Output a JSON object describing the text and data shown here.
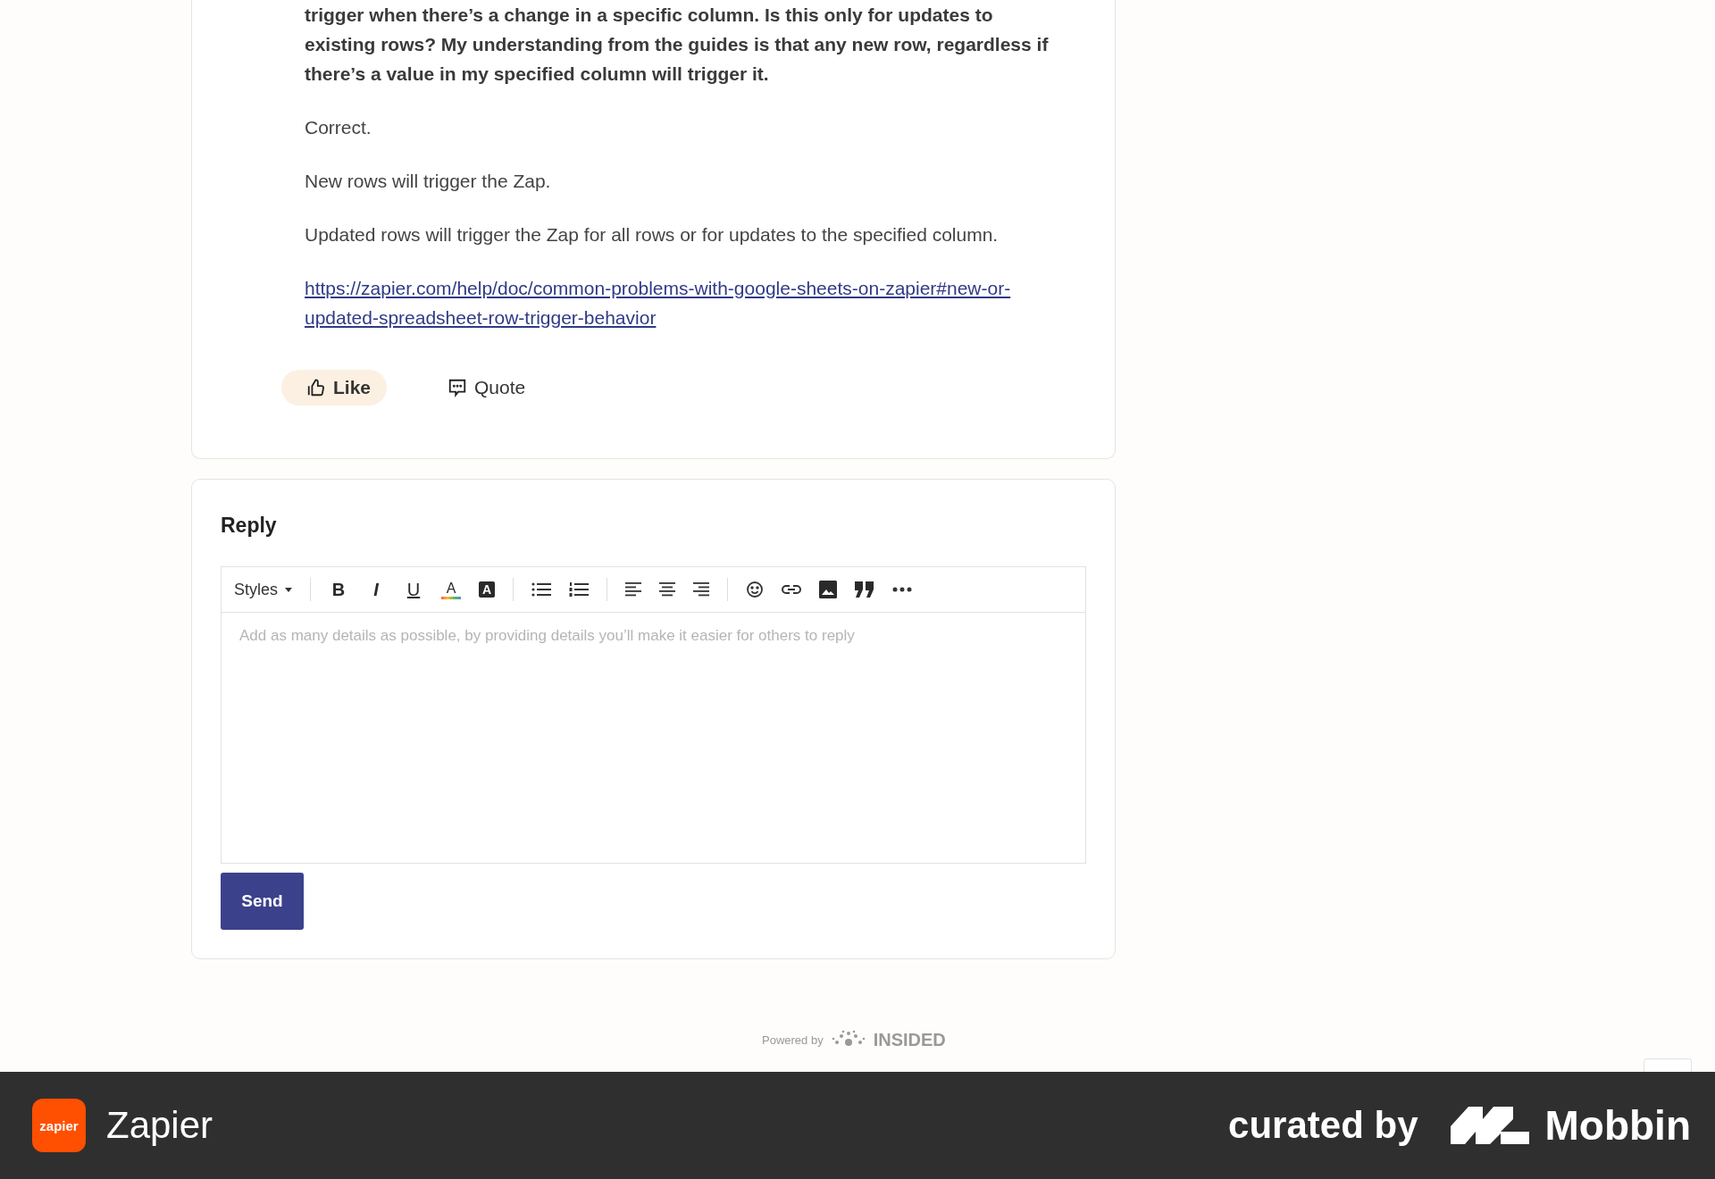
{
  "post": {
    "question": "trigger when there’s a change in a specific column. Is this only for updates to existing rows? My understanding from the guides is that any new row, regardless if there’s a value in my specified column will trigger it.",
    "paragraphs": [
      "Correct.",
      "New rows will trigger the Zap.",
      "Updated rows will trigger the Zap for all rows or for updates to the specified column."
    ],
    "link": "https://zapier.com/help/doc/common-problems-with-google-sheets-on-zapier#new-or-updated-spreadsheet-row-trigger-behavior",
    "actions": [
      {
        "kind": "like",
        "label": "Like",
        "selected": true
      },
      {
        "kind": "quote",
        "label": "Quote",
        "selected": false
      }
    ]
  },
  "reply": {
    "title": "Reply",
    "styles": "Styles",
    "tools": [
      {
        "kind": "bold",
        "glyph": "B"
      },
      {
        "kind": "italic",
        "glyph": "I"
      },
      {
        "kind": "underline",
        "glyph": "U"
      },
      {
        "kind": "text-color",
        "glyph": "A"
      },
      {
        "kind": "highlight",
        "glyph": "A"
      },
      {
        "kind": "separator"
      },
      {
        "kind": "bullets"
      },
      {
        "kind": "numbers"
      },
      {
        "kind": "separator"
      },
      {
        "kind": "align-left"
      },
      {
        "kind": "align-center"
      },
      {
        "kind": "align-right"
      },
      {
        "kind": "separator"
      },
      {
        "kind": "emoji"
      },
      {
        "kind": "link"
      },
      {
        "kind": "image"
      },
      {
        "kind": "quote"
      },
      {
        "kind": "more"
      }
    ],
    "placeholder": "Add as many details as possible, by providing details you’ll make it easier for others to reply",
    "send": "Send"
  },
  "powered_by": {
    "text": "Powered by",
    "brand": "INSIDED"
  },
  "footer": {
    "logo_text": "zapier",
    "app_name": "Zapier",
    "curated": "curated by",
    "brand": "Mobbin"
  }
}
